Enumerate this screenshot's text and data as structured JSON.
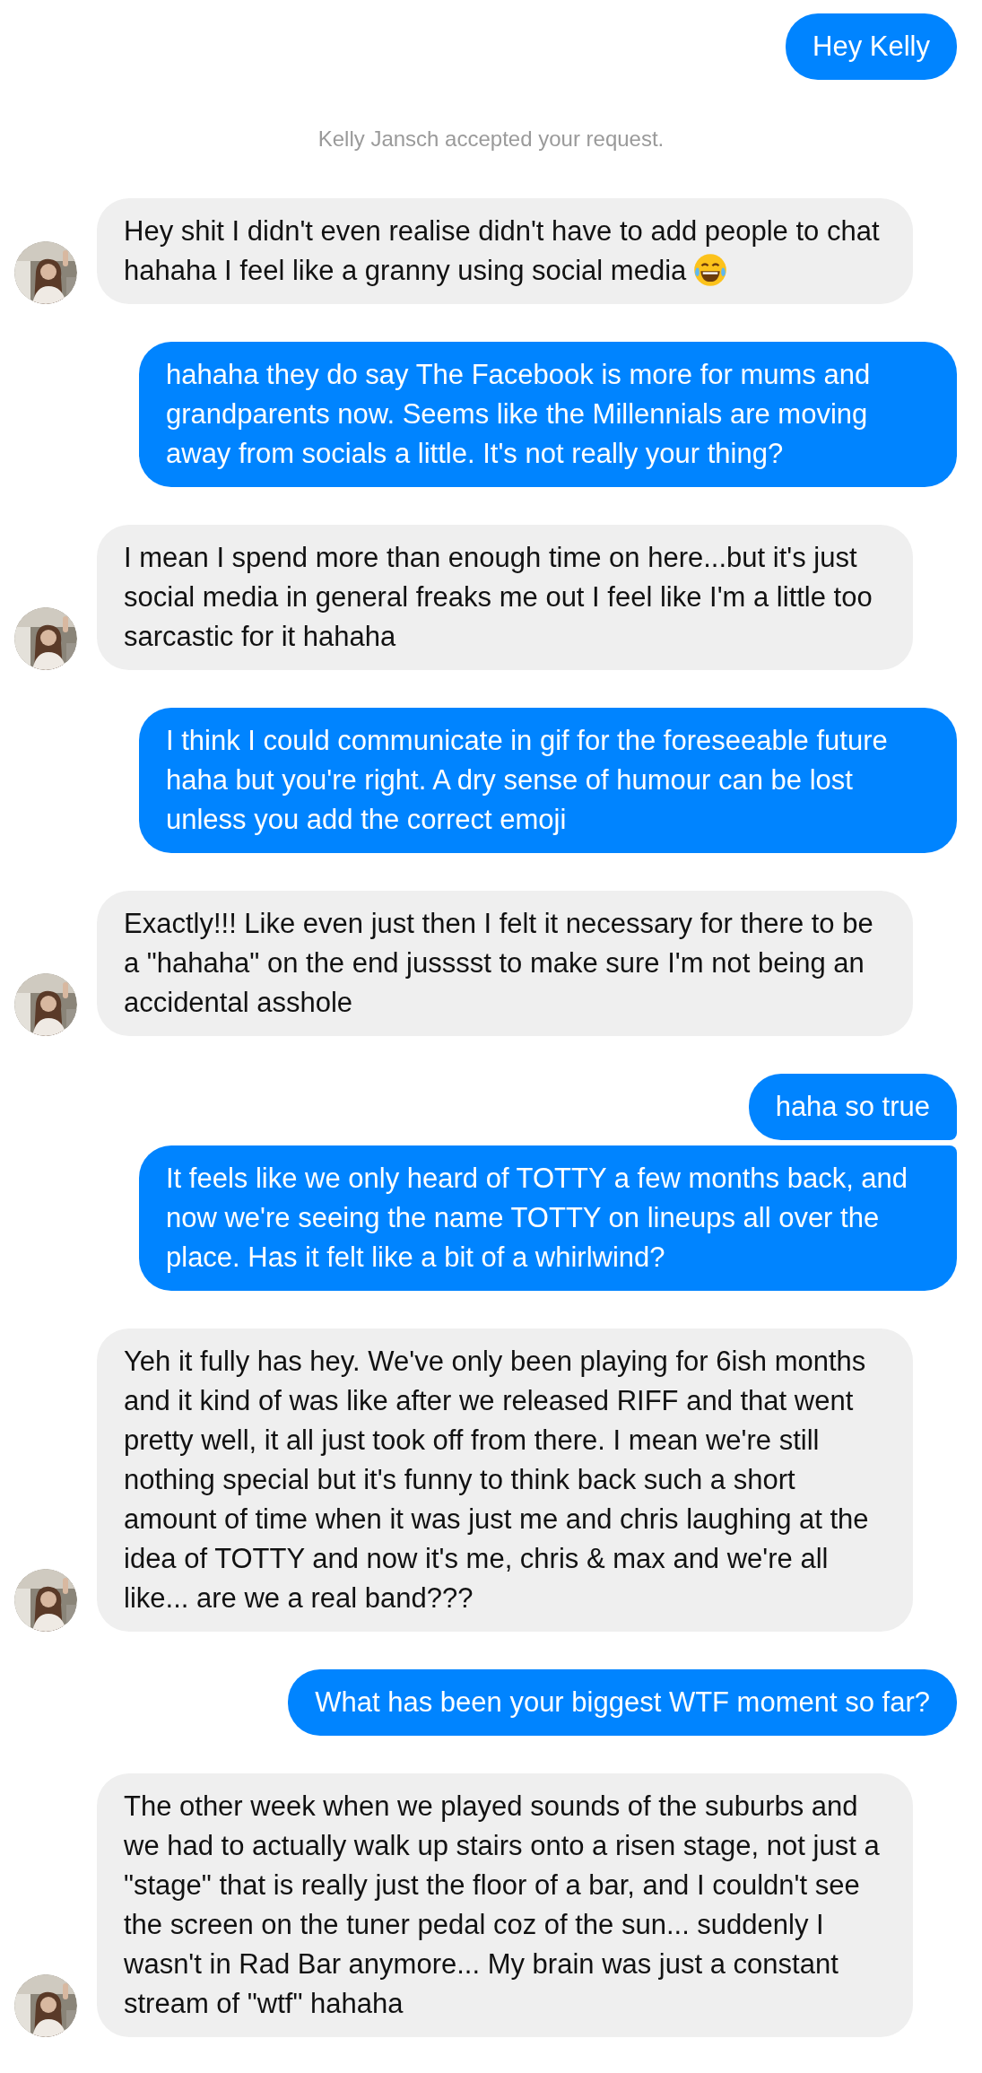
{
  "messages": [
    {
      "kind": "outgoing",
      "text": "Hey Kelly"
    },
    {
      "kind": "system",
      "text": "Kelly Jansch accepted your request."
    },
    {
      "kind": "incoming",
      "text": "Hey shit I didn't even realise didn't have to add people to chat hahaha I feel like a granny using social media",
      "laughing_emoji": true
    },
    {
      "kind": "outgoing",
      "text": "hahaha they do say The Facebook is more for mums and grandparents now. Seems like the Millennials are moving away from socials a little. It's not really your thing?"
    },
    {
      "kind": "incoming",
      "text": "I mean I spend more than enough time on here...but it's just social media in general freaks me out I feel like I'm a little too sarcastic for it hahaha"
    },
    {
      "kind": "outgoing",
      "text": "I think I could communicate in gif for the foreseeable future haha but you're right. A dry sense of humour can be lost unless you add the correct emoji"
    },
    {
      "kind": "incoming",
      "text": "Exactly!!! Like even just then I felt it necessary for there to be a \"hahaha\" on the end jusssst to make sure I'm not being an accidental asshole"
    },
    {
      "kind": "outgoing",
      "text": "haha so true",
      "joined_below": true,
      "joined_above": false
    },
    {
      "kind": "outgoing",
      "text": "It feels like we only heard of TOTTY a few months back, and now we're seeing the name TOTTY on lineups all over the place. Has it felt like a bit of a whirlwind?",
      "joined_below": false,
      "joined_above": true
    },
    {
      "kind": "incoming",
      "text": "Yeh it fully has hey. We've only been playing for 6ish months and it kind of was like after we released RIFF and that went pretty well, it all just took off from there. I mean we're still nothing special but it's funny to think back such a short amount of time when it was just me and chris laughing at the idea of TOTTY and now it's me, chris & max and we're all like... are we a real band???"
    },
    {
      "kind": "outgoing",
      "text": "What has been your biggest WTF moment so far?"
    },
    {
      "kind": "incoming",
      "text": "The other week when we played sounds of the suburbs and we had to actually walk up stairs onto a risen stage, not just a \"stage\" that is really just the floor of a bar, and I couldn't see the screen on the tuner pedal coz of the sun... suddenly I wasn't in Rad Bar anymore... My brain was just a constant stream of \"wtf\" hahaha"
    }
  ]
}
